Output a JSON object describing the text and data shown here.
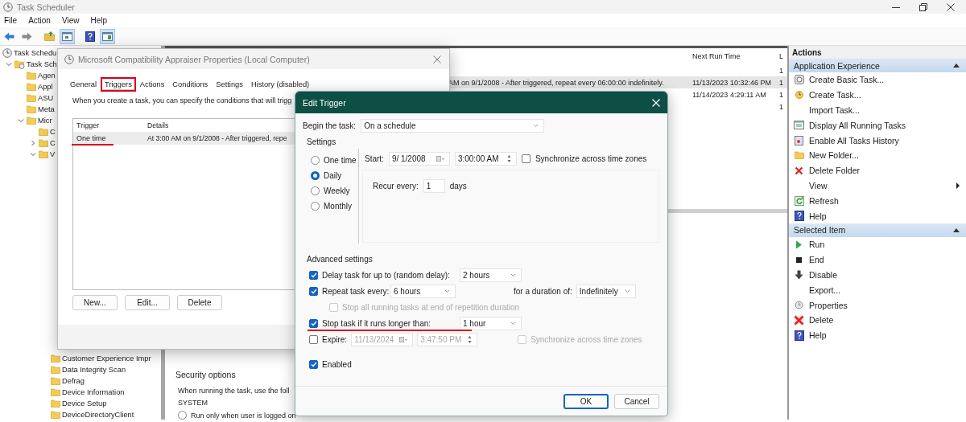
{
  "window": {
    "title": "Task Scheduler"
  },
  "menu": [
    "File",
    "Action",
    "View",
    "Help"
  ],
  "toolbar": [
    {
      "pressed": false
    },
    {
      "pressed": false
    },
    {
      "pressed": false
    },
    {
      "pressed": true
    },
    {
      "pressed": false
    },
    {
      "pressed": true
    }
  ],
  "tree": [
    {
      "label": "Task Schedu",
      "kind": "root",
      "children": [
        {
          "label": "Task Sch",
          "kind": "library",
          "expandable": true,
          "expanded": true,
          "children": [
            {
              "label": "Agen",
              "kind": "folder",
              "expandable": false,
              "expanded": false
            },
            {
              "label": "Appl",
              "kind": "folder",
              "expandable": false,
              "expanded": false
            },
            {
              "label": "ASU",
              "kind": "folder",
              "expandable": false,
              "expanded": false
            },
            {
              "label": "Meta",
              "kind": "folder",
              "expandable": false,
              "expanded": false
            },
            {
              "label": "Micr",
              "kind": "folder",
              "expandable": true,
              "expanded": true,
              "children": [
                {
                  "label": "C",
                  "kind": "folder",
                  "expandable": false,
                  "expanded": false
                },
                {
                  "label": "C",
                  "kind": "folder",
                  "expandable": true,
                  "expanded": false
                },
                {
                  "label": "V",
                  "kind": "folder",
                  "expandable": true,
                  "expanded": true,
                  "children": [
                    {
                      "label": "Customer Experience Impr",
                      "kind": "folder",
                      "expandable": false,
                      "expanded": false
                    },
                    {
                      "label": "Data Integrity Scan",
                      "kind": "folder",
                      "expandable": false,
                      "expanded": false
                    },
                    {
                      "label": "Defrag",
                      "kind": "folder",
                      "expandable": false,
                      "expanded": false
                    },
                    {
                      "label": "Device Information",
                      "kind": "folder",
                      "expandable": false,
                      "expanded": false
                    },
                    {
                      "label": "Device Setup",
                      "kind": "folder",
                      "expandable": false,
                      "expanded": false
                    },
                    {
                      "label": "DeviceDirectoryClient",
                      "kind": "folder",
                      "expandable": false,
                      "expanded": false
                    }
                  ]
                }
              ]
            }
          ]
        }
      ]
    }
  ],
  "task_list": {
    "columns": [
      "Next Run Time",
      "L"
    ],
    "rows": [
      {
        "column_3": "1",
        "selected": false
      },
      {
        "trigger": "AM on 9/1/2008 - After triggered, repeat every 06:00:00 indefinitely.",
        "next_run": "11/13/2023 10:32:46 PM",
        "column_3": "1",
        "selected": true
      },
      {
        "next_run": "11/14/2023 4:29:11 AM",
        "column_3": "1",
        "selected": false
      },
      {
        "column_3": "1",
        "selected": false
      }
    ]
  },
  "details": {
    "section": "Security options",
    "text": "When running the task, use the foll",
    "account": "SYSTEM",
    "options": [
      {
        "label": "Run only when user is logged on",
        "selected": false
      }
    ]
  },
  "actions_pane": {
    "title": "Actions",
    "sections": [
      {
        "title": "Application Experience",
        "expanded": true,
        "items": [
          {
            "label": "Create Basic Task...",
            "submenu": false
          },
          {
            "label": "Create Task...",
            "submenu": false
          },
          {
            "label": "Import Task...",
            "submenu": false
          },
          {
            "label": "Display All Running Tasks",
            "submenu": false
          },
          {
            "label": "Enable All Tasks History",
            "submenu": false
          },
          {
            "label": "New Folder...",
            "submenu": false
          },
          {
            "label": "Delete Folder",
            "submenu": false
          },
          {
            "label": "View",
            "submenu": true
          },
          {
            "label": "Refresh",
            "submenu": false
          },
          {
            "label": "Help",
            "submenu": false
          }
        ]
      },
      {
        "title": "Selected Item",
        "expanded": true,
        "items": [
          {
            "label": "Run",
            "submenu": false
          },
          {
            "label": "End",
            "submenu": false
          },
          {
            "label": "Disable",
            "submenu": false
          },
          {
            "label": "Export...",
            "submenu": false
          },
          {
            "label": "Properties",
            "submenu": false
          },
          {
            "label": "Delete",
            "submenu": false
          },
          {
            "label": "Help",
            "submenu": false
          }
        ]
      }
    ]
  },
  "properties_dialog": {
    "title": "Microsoft Compatibility Appraiser Properties (Local Computer)",
    "tabs": [
      {
        "label": "General",
        "selected": false,
        "highlighted": false
      },
      {
        "label": "Triggers",
        "selected": true,
        "highlighted": true
      },
      {
        "label": "Actions",
        "selected": false,
        "highlighted": false
      },
      {
        "label": "Conditions",
        "selected": false,
        "highlighted": false
      },
      {
        "label": "Settings",
        "selected": false,
        "highlighted": false
      },
      {
        "label": "History (disabled)",
        "selected": false,
        "highlighted": false
      }
    ],
    "description": "When you create a task, you can specify the conditions that will trigg",
    "table": {
      "columns": [
        "Trigger",
        "Details"
      ],
      "rows": [
        {
          "cells": [
            "One time",
            "At 3:00 AM on 9/1/2008 - After triggered, repe"
          ],
          "selected": true,
          "underlined": true
        }
      ]
    },
    "buttons": [
      "New...",
      "Edit...",
      "Delete"
    ]
  },
  "edit_trigger": {
    "title": "Edit Trigger",
    "begin_label": "Begin the task:",
    "begin_value": "On a schedule",
    "settings_label": "Settings",
    "schedules": [
      {
        "label": "One time",
        "selected": false
      },
      {
        "label": "Daily",
        "selected": true
      },
      {
        "label": "Weekly",
        "selected": false
      },
      {
        "label": "Monthly",
        "selected": false
      }
    ],
    "start_label": "Start:",
    "start_date": "9/ 1/2008",
    "start_time": "3:00:00 AM",
    "sync": {
      "label": "Synchronize across time zones",
      "checked": false
    },
    "recur_label": "Recur every:",
    "recur_value": "1",
    "recur_unit": "days",
    "advanced_label": "Advanced settings",
    "options": [
      {
        "kind": "dropdown",
        "label": "Delay task for up to (random delay):",
        "checked": true,
        "disabled": false,
        "underlined": false,
        "value": "2 hours"
      },
      {
        "kind": "repeat",
        "label": "Repeat task every:",
        "checked": true,
        "disabled": false,
        "underlined": false,
        "value": "6 hours",
        "duration_label": "for a duration of:",
        "duration_value": "Indefinitely"
      },
      {
        "kind": "sub",
        "label": "Stop all running tasks at end of repetition duration",
        "checked": false,
        "disabled": true,
        "underlined": false
      },
      {
        "kind": "dropdown",
        "label": "Stop task if it runs longer than:",
        "checked": true,
        "disabled": false,
        "underlined": true,
        "value": "1 hour"
      },
      {
        "kind": "expire",
        "label": "Expire:",
        "checked": false,
        "disabled": false,
        "underlined": false,
        "date": "11/13/2024",
        "time": "3:47:50 PM",
        "sync_label": "Synchronize across time zones",
        "sync_checked": false
      },
      {
        "kind": "plain",
        "label": "Enabled",
        "checked": true,
        "disabled": false,
        "underlined": false
      }
    ],
    "buttons": [
      {
        "label": "OK",
        "default": true
      },
      {
        "label": "Cancel",
        "default": false
      }
    ]
  }
}
